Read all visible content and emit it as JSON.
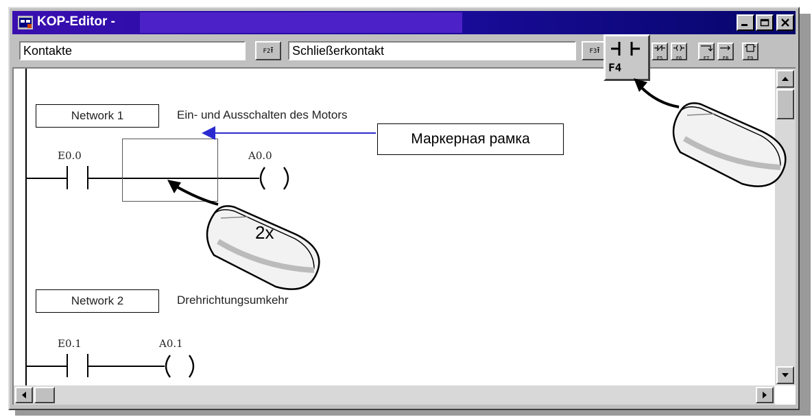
{
  "window": {
    "title": "KOP-Editor -",
    "controls": [
      "minimize",
      "maximize",
      "close"
    ]
  },
  "toolbar": {
    "category_value": "Kontakte",
    "category_button": "F2",
    "element_value": "Schließerkontakt",
    "element_button": "F3",
    "buttons": [
      {
        "key": "F4",
        "icon": "normally-open-contact-icon"
      },
      {
        "key": "F5",
        "icon": "normally-closed-contact-icon"
      },
      {
        "key": "F6",
        "icon": "coil-icon"
      },
      {
        "key": "F7",
        "icon": "branch-open-icon"
      },
      {
        "key": "F8",
        "icon": "branch-close-icon"
      },
      {
        "key": "F9",
        "icon": "box-icon"
      }
    ],
    "f4_label": "F4"
  },
  "networks": [
    {
      "label": "Network 1",
      "comment": "Ein- und Ausschalten des Motors",
      "contact": "E0.0",
      "coil": "A0.0"
    },
    {
      "label": "Network 2",
      "comment": "Drehrichtungsumkehr",
      "contact": "E0.1",
      "coil": "A0.1"
    }
  ],
  "annotation": {
    "callout": "Маркерная рамка",
    "double_click": "2x"
  },
  "colors": {
    "title_gradient_start": "#3a0fb0",
    "title_gradient_end": "#06066a",
    "callout_arrow": "#2a2ad0"
  }
}
